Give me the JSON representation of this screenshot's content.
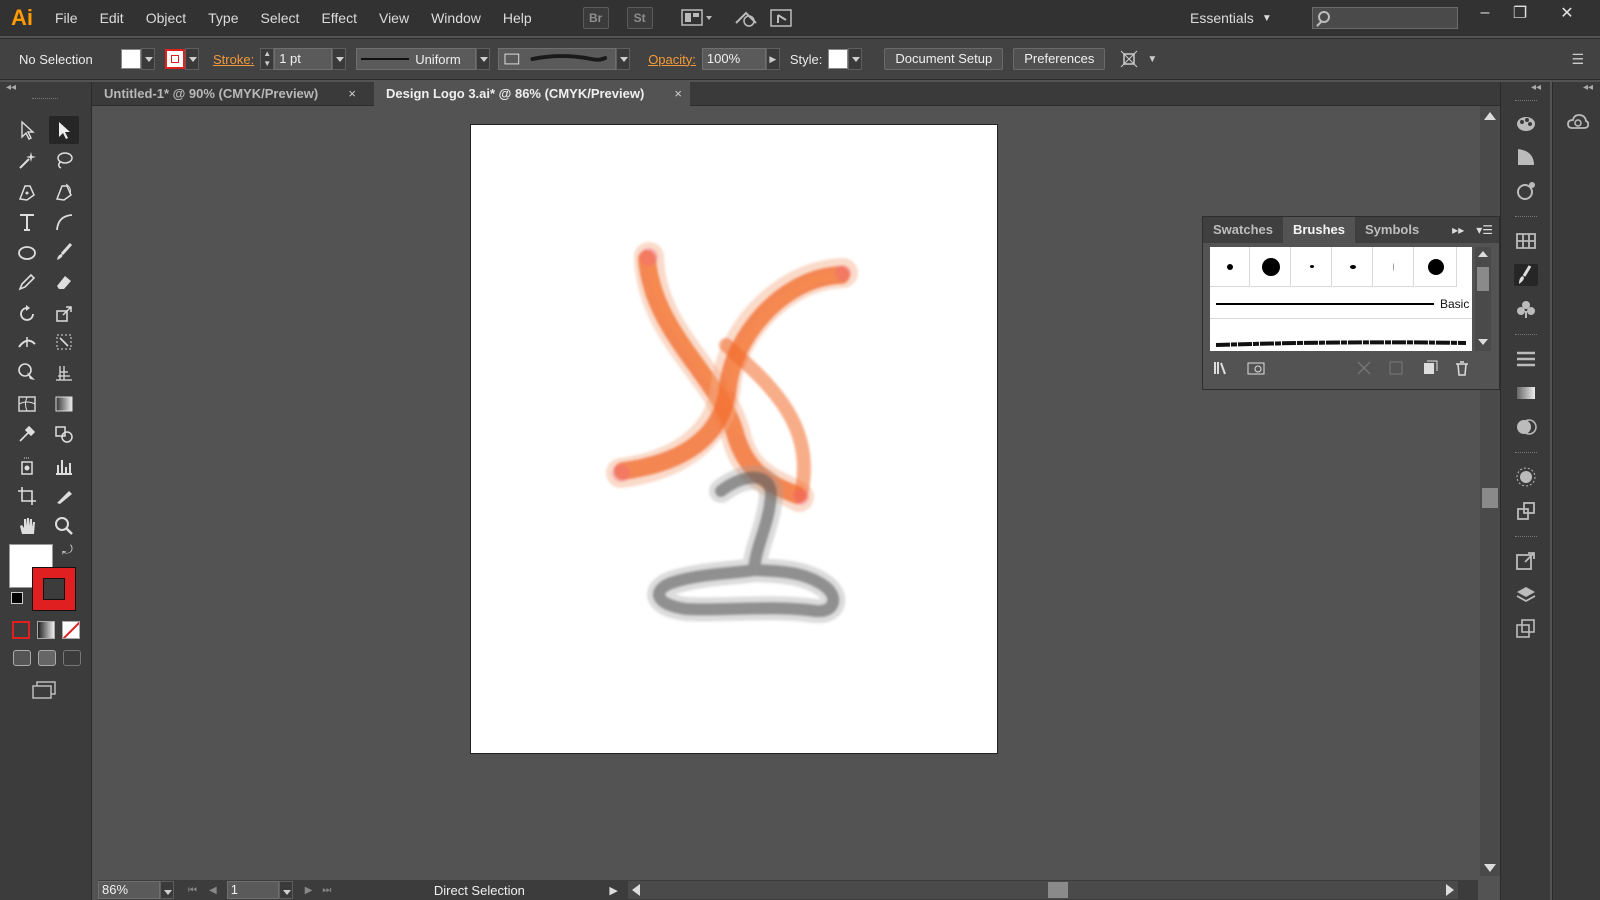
{
  "app": {
    "logo": "Ai"
  },
  "menu": {
    "items": [
      "File",
      "Edit",
      "Object",
      "Type",
      "Select",
      "Effect",
      "View",
      "Window",
      "Help"
    ],
    "bridge_label": "Br",
    "stock_label": "St",
    "workspace": "Essentials"
  },
  "control_bar": {
    "selection_text": "No Selection",
    "stroke_label": "Stroke:",
    "stroke_weight": "1 pt",
    "profile_label": "Uniform",
    "opacity_label": "Opacity:",
    "opacity_value": "100%",
    "style_label": "Style:",
    "doc_setup_label": "Document Setup",
    "preferences_label": "Preferences"
  },
  "tabs": [
    {
      "label": "Untitled-1* @ 90% (CMYK/Preview)",
      "close": "×"
    },
    {
      "label": "Design Logo 3.ai* @ 86% (CMYK/Preview)",
      "close": "×"
    }
  ],
  "brush_panel": {
    "tabs": [
      "Swatches",
      "Brushes",
      "Symbols"
    ],
    "basic_label": "Basic"
  },
  "status": {
    "zoom": "86%",
    "page": "1",
    "tool": "Direct Selection"
  },
  "colors": {
    "accent_orange": "#ff9a00",
    "stroke_red": "#e02020",
    "brush_orange": "#f36a2a",
    "brush_gray": "#5b5b5b"
  }
}
